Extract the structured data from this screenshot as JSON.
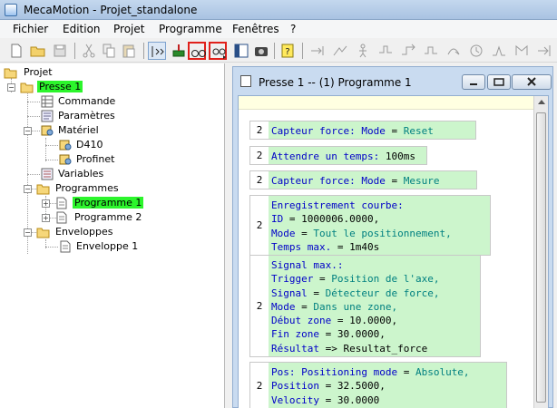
{
  "window": {
    "title": "MecaMotion - Projet_standalone"
  },
  "menu": [
    "Fichier",
    "Edition",
    "Projet",
    "Programme",
    "Fenêtres",
    "?"
  ],
  "tree": {
    "root": "Projet",
    "presse": "Presse 1",
    "commande": "Commande",
    "parametres": "Paramètres",
    "materiel": "Matériel",
    "d410": "D410",
    "profinet": "Profinet",
    "variables": "Variables",
    "programmes": "Programmes",
    "programme1": "Programme 1",
    "programme2": "Programme 2",
    "enveloppes": "Enveloppes",
    "enveloppe1": "Enveloppe 1"
  },
  "child_window": {
    "title": "Presse 1 -- (1) Programme 1"
  },
  "blocks": [
    {
      "num": "2",
      "lines": [
        [
          [
            "k",
            "Capteur force: Mode"
          ],
          [
            "t",
            " = "
          ],
          [
            "v",
            "Reset"
          ]
        ]
      ]
    },
    {
      "num": "2",
      "lines": [
        [
          [
            "k",
            "Attendre un temps:"
          ],
          [
            "t",
            " 100ms"
          ]
        ]
      ]
    },
    {
      "num": "2",
      "lines": [
        [
          [
            "k",
            "Capteur force: Mode"
          ],
          [
            "t",
            " = "
          ],
          [
            "v",
            "Mesure"
          ]
        ]
      ]
    },
    {
      "num": "2",
      "lines": [
        [
          [
            "k",
            "Enregistrement courbe:"
          ]
        ],
        [
          [
            "k",
            "ID"
          ],
          [
            "t",
            " = 1000006.0000,"
          ]
        ],
        [
          [
            "k",
            "Mode"
          ],
          [
            "t",
            " = "
          ],
          [
            "v",
            "Tout le positionnement,"
          ]
        ],
        [
          [
            "k",
            "Temps max."
          ],
          [
            "t",
            " = 1m40s"
          ]
        ]
      ]
    },
    {
      "num": "2",
      "lines": [
        [
          [
            "k",
            "Signal max.:"
          ]
        ],
        [
          [
            "k",
            "Trigger"
          ],
          [
            "t",
            " = "
          ],
          [
            "v",
            "Position de l'axe,"
          ]
        ],
        [
          [
            "k",
            "Signal"
          ],
          [
            "t",
            " = "
          ],
          [
            "v",
            "Détecteur de force,"
          ]
        ],
        [
          [
            "k",
            "Mode"
          ],
          [
            "t",
            " = "
          ],
          [
            "v",
            "Dans une zone,"
          ]
        ],
        [
          [
            "k",
            "Début zone"
          ],
          [
            "t",
            " = 10.0000,"
          ]
        ],
        [
          [
            "k",
            "Fin zone"
          ],
          [
            "t",
            " = 30.0000,"
          ]
        ],
        [
          [
            "k",
            "Résultat"
          ],
          [
            "t",
            " => Resultat_force"
          ]
        ]
      ]
    },
    {
      "num": "2",
      "lines": [
        [
          [
            "k",
            "Pos: Positioning mode"
          ],
          [
            "t",
            " = "
          ],
          [
            "v",
            "Absolute,"
          ]
        ],
        [
          [
            "k",
            "Position"
          ],
          [
            "t",
            " = 32.5000,"
          ]
        ],
        [
          [
            "k",
            "Velocity"
          ],
          [
            "t",
            " = 30.0000"
          ]
        ]
      ]
    }
  ],
  "colors": {
    "selection": "#2cf52c",
    "code_bg": "#ccf5cc",
    "keyword": "#0000c8",
    "value": "#008080",
    "highlight_border": "#e0201a"
  }
}
